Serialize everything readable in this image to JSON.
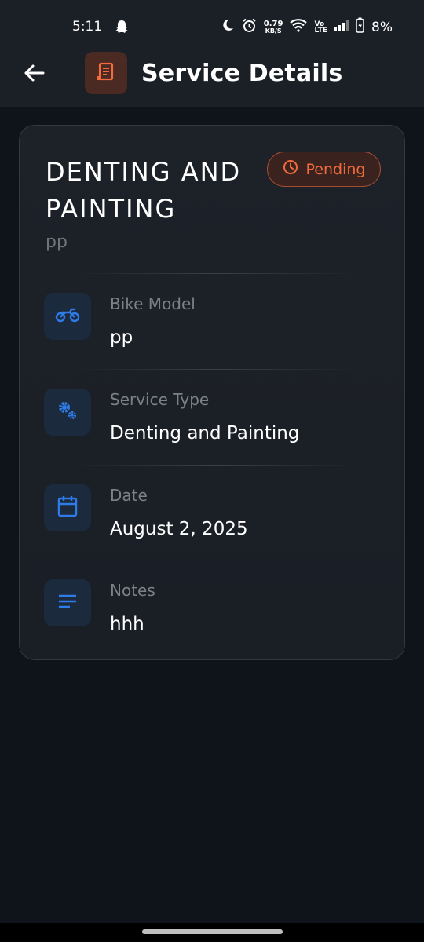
{
  "status_bar": {
    "time": "5:11",
    "net_speed_value": "0.79",
    "net_speed_unit": "KB/S",
    "volte_top": "Vo",
    "volte_bottom": "LTE",
    "battery": "8%"
  },
  "app_bar": {
    "title": "Service Details",
    "accent_color": "#f26a3d"
  },
  "service": {
    "name": "DENTING AND PAINTING",
    "subtitle": "pp",
    "status": "Pending"
  },
  "details": [
    {
      "icon": "motorcycle-icon",
      "label": "Bike Model",
      "value": "pp"
    },
    {
      "icon": "gears-icon",
      "label": "Service Type",
      "value": "Denting and Painting"
    },
    {
      "icon": "calendar-icon",
      "label": "Date",
      "value": "August 2, 2025"
    },
    {
      "icon": "notes-icon",
      "label": "Notes",
      "value": "hhh"
    }
  ],
  "colors": {
    "background": "#0f131a",
    "card": "#1d2128",
    "icon_blue": "#2f7be8",
    "pending_orange": "#f26a3d"
  }
}
